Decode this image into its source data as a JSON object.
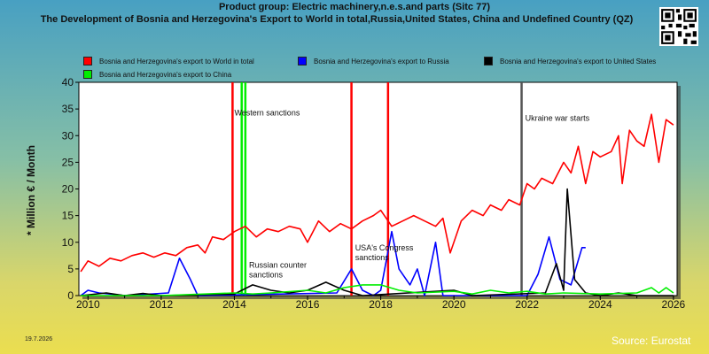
{
  "title_line1": "Product group: Electric machinery,n.e.s.and parts (Sitc 77)",
  "title_line2": "The Development of Bosnia and Herzegovina's Export to World in total,Russia,United States, China and Undefined Country (QZ)",
  "y_axis_label": "* Million € / Month",
  "date_stamp": "19.7.2026",
  "source": "Source: Eurostat",
  "legend": [
    {
      "label": "Bosnia and Herzegovina's export to World in total",
      "color": "#ff0000"
    },
    {
      "label": "Bosnia and Herzegovina's export to Russia",
      "color": "#0000ff"
    },
    {
      "label": "Bosnia and Herzegovina's export to United States",
      "color": "#000000"
    },
    {
      "label": "Bosnia and Herzegovina's export to China",
      "color": "#00ee00"
    }
  ],
  "chart_data": {
    "type": "line",
    "x_unit": "year",
    "xlim": [
      2009.75,
      2026.1
    ],
    "ylim": [
      0,
      40
    ],
    "x_ticks": [
      2010,
      2012,
      2014,
      2016,
      2018,
      2020,
      2022,
      2024,
      2026
    ],
    "y_ticks": [
      0,
      5,
      10,
      15,
      20,
      25,
      30,
      35,
      40
    ],
    "grid": false,
    "legend_position": "top",
    "events": [
      {
        "x": 2014.3,
        "label": "Western sanctions",
        "color": "#00ee00"
      },
      {
        "x": 2014.2,
        "label": "Russian counter sanctions",
        "color": "#00ee00"
      },
      {
        "x": 2013.95,
        "label": "",
        "color": "#ff0000"
      },
      {
        "x": 2017.2,
        "label": "USA's Congress sanctions",
        "color": "#ff0000"
      },
      {
        "x": 2018.2,
        "label": "",
        "color": "#ff0000"
      },
      {
        "x": 2021.85,
        "label": "Ukraine war starts",
        "color": "#555555"
      }
    ],
    "series": [
      {
        "name": "Bosnia and Herzegovina's export to World in total",
        "color": "#ff0000",
        "points": [
          [
            2009.8,
            4.5
          ],
          [
            2010,
            6.5
          ],
          [
            2010.3,
            5.5
          ],
          [
            2010.6,
            7
          ],
          [
            2010.9,
            6.5
          ],
          [
            2011.2,
            7.5
          ],
          [
            2011.5,
            8
          ],
          [
            2011.8,
            7.2
          ],
          [
            2012.1,
            8
          ],
          [
            2012.4,
            7.5
          ],
          [
            2012.7,
            9
          ],
          [
            2013,
            9.5
          ],
          [
            2013.2,
            8
          ],
          [
            2013.4,
            11
          ],
          [
            2013.7,
            10.5
          ],
          [
            2014,
            12
          ],
          [
            2014.3,
            13
          ],
          [
            2014.6,
            11
          ],
          [
            2014.9,
            12.5
          ],
          [
            2015.2,
            12
          ],
          [
            2015.5,
            13
          ],
          [
            2015.8,
            12.5
          ],
          [
            2016,
            10
          ],
          [
            2016.3,
            14
          ],
          [
            2016.6,
            12
          ],
          [
            2016.9,
            13.5
          ],
          [
            2017.2,
            12.5
          ],
          [
            2017.5,
            14
          ],
          [
            2017.8,
            15
          ],
          [
            2018,
            16
          ],
          [
            2018.3,
            13
          ],
          [
            2018.6,
            14
          ],
          [
            2018.9,
            15
          ],
          [
            2019.2,
            14
          ],
          [
            2019.5,
            13
          ],
          [
            2019.7,
            14.5
          ],
          [
            2019.9,
            8
          ],
          [
            2020.2,
            14
          ],
          [
            2020.5,
            16
          ],
          [
            2020.8,
            15
          ],
          [
            2021,
            17
          ],
          [
            2021.3,
            16
          ],
          [
            2021.5,
            18
          ],
          [
            2021.8,
            17
          ],
          [
            2022,
            21
          ],
          [
            2022.2,
            20
          ],
          [
            2022.4,
            22
          ],
          [
            2022.7,
            21
          ],
          [
            2023,
            25
          ],
          [
            2023.2,
            23
          ],
          [
            2023.4,
            28
          ],
          [
            2023.6,
            21
          ],
          [
            2023.8,
            27
          ],
          [
            2024,
            26
          ],
          [
            2024.3,
            27
          ],
          [
            2024.5,
            30
          ],
          [
            2024.6,
            21
          ],
          [
            2024.8,
            31
          ],
          [
            2025,
            29
          ],
          [
            2025.2,
            28
          ],
          [
            2025.4,
            34
          ],
          [
            2025.6,
            25
          ],
          [
            2025.8,
            33
          ],
          [
            2026,
            32
          ]
        ]
      },
      {
        "name": "Bosnia and Herzegovina's export to Russia",
        "color": "#0000ff",
        "points": [
          [
            2009.8,
            0
          ],
          [
            2010,
            1
          ],
          [
            2010.3,
            0.5
          ],
          [
            2010.6,
            0.3
          ],
          [
            2011,
            0
          ],
          [
            2012.2,
            0.5
          ],
          [
            2012.5,
            7
          ],
          [
            2012.8,
            3
          ],
          [
            2013,
            0
          ],
          [
            2016.8,
            0.5
          ],
          [
            2017.2,
            5
          ],
          [
            2017.5,
            1
          ],
          [
            2017.8,
            0
          ],
          [
            2018,
            1
          ],
          [
            2018.3,
            12
          ],
          [
            2018.5,
            5
          ],
          [
            2018.8,
            2
          ],
          [
            2019,
            5
          ],
          [
            2019.2,
            0
          ],
          [
            2019.5,
            10
          ],
          [
            2019.7,
            0
          ],
          [
            2022,
            0
          ],
          [
            2022.3,
            4
          ],
          [
            2022.6,
            11
          ],
          [
            2022.9,
            3
          ],
          [
            2023.2,
            2
          ],
          [
            2023.5,
            9
          ],
          [
            2023.6,
            9
          ]
        ]
      },
      {
        "name": "Bosnia and Herzegovina's export to United States",
        "color": "#000000",
        "points": [
          [
            2009.8,
            0
          ],
          [
            2010.5,
            0.5
          ],
          [
            2011,
            0
          ],
          [
            2011.5,
            0.4
          ],
          [
            2012,
            0
          ],
          [
            2014,
            0.3
          ],
          [
            2014.5,
            2
          ],
          [
            2015,
            1
          ],
          [
            2015.5,
            0.5
          ],
          [
            2016,
            1
          ],
          [
            2016.5,
            2.5
          ],
          [
            2017,
            1
          ],
          [
            2017.5,
            0
          ],
          [
            2020,
            1
          ],
          [
            2020.5,
            0
          ],
          [
            2022.5,
            0.5
          ],
          [
            2022.8,
            6
          ],
          [
            2023,
            1
          ],
          [
            2023.1,
            20
          ],
          [
            2023.3,
            3
          ],
          [
            2023.6,
            0.5
          ],
          [
            2024,
            0
          ],
          [
            2024.5,
            0.5
          ],
          [
            2025,
            0
          ],
          [
            2026,
            0
          ]
        ]
      },
      {
        "name": "Bosnia and Herzegovina's export to China",
        "color": "#00ee00",
        "points": [
          [
            2009.8,
            0
          ],
          [
            2012,
            0
          ],
          [
            2014,
            0.5
          ],
          [
            2014.5,
            0.3
          ],
          [
            2015,
            0.5
          ],
          [
            2016,
            1
          ],
          [
            2016.5,
            0.5
          ],
          [
            2017,
            1.5
          ],
          [
            2017.5,
            2
          ],
          [
            2018,
            2
          ],
          [
            2018.5,
            1
          ],
          [
            2019,
            0.5
          ],
          [
            2020,
            0.8
          ],
          [
            2020.5,
            0.3
          ],
          [
            2021,
            1
          ],
          [
            2021.5,
            0.5
          ],
          [
            2022,
            0.8
          ],
          [
            2022.5,
            0.3
          ],
          [
            2023,
            0.5
          ],
          [
            2024,
            0.3
          ],
          [
            2025,
            0.5
          ],
          [
            2025.4,
            1.5
          ],
          [
            2025.6,
            0.5
          ],
          [
            2025.8,
            1.5
          ],
          [
            2026,
            0.5
          ]
        ]
      }
    ]
  }
}
